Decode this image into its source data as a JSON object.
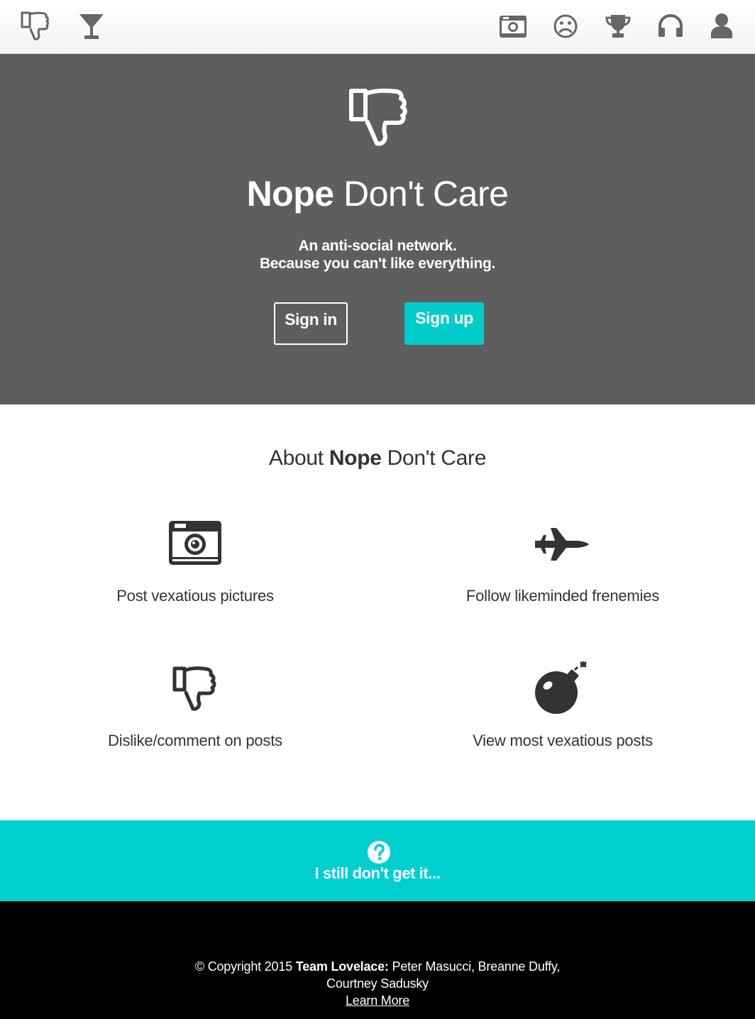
{
  "nav": {
    "icons": [
      "thumbs-down-icon",
      "cocktail-icon",
      "camera-icon",
      "frown-icon",
      "trophy-icon",
      "headphones-icon",
      "user-icon"
    ]
  },
  "hero": {
    "title_bold": "Nope",
    "title_rest": " Don't Care",
    "subtitle_line1": "An anti-social network.",
    "subtitle_line2": "Because you can't like everything.",
    "signin_label": "Sign in",
    "signup_label": "Sign up",
    "background_color": "#5e5e5e",
    "accent_color": "#00cccc"
  },
  "about": {
    "title_prefix": "About ",
    "title_bold": "Nope",
    "title_rest": " Don't Care",
    "features": [
      {
        "icon": "camera-icon",
        "label": "Post vexatious pictures"
      },
      {
        "icon": "jet-plane-icon",
        "label": "Follow likeminded frenemies"
      },
      {
        "icon": "thumbs-down-icon",
        "label": "Dislike/comment on posts"
      },
      {
        "icon": "bomb-icon",
        "label": "View most vexatious posts"
      }
    ]
  },
  "cta": {
    "icon": "question-circle-icon",
    "label": "I still don't get it..."
  },
  "footer": {
    "copyright": "© Copyright 2015 ",
    "team": "Team Lovelace:",
    "members_line1": " Peter Masucci, Breanne Duffy,",
    "members_line2": "Courtney Sadusky",
    "learn_more": "Learn More"
  }
}
